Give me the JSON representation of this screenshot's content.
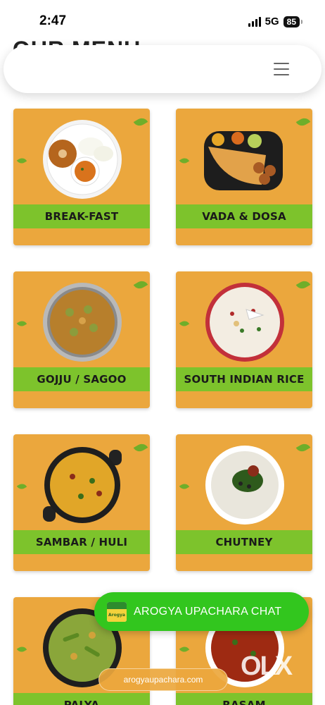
{
  "status": {
    "time": "2:47",
    "network": "5G",
    "battery": "85"
  },
  "header": {
    "title": "OUR MENU",
    "menu_icon": "hamburger-icon"
  },
  "categories": [
    {
      "label": "BREAK-FAST"
    },
    {
      "label": "VADA & DOSA"
    },
    {
      "label": "GOJJU / SAGOO"
    },
    {
      "label": "SOUTH INDIAN RICE"
    },
    {
      "label": "SAMBAR / HULI"
    },
    {
      "label": "CHUTNEY"
    },
    {
      "label": "PALYA"
    },
    {
      "label": "RASAM"
    }
  ],
  "chat": {
    "label": "AROGYA UPACHARA CHAT",
    "logo_text": "Arogya"
  },
  "url": "arogyaupachara.com",
  "watermark": "OLX",
  "colors": {
    "card": "#eba73d",
    "band": "#7dc32c",
    "chat": "#32c61e"
  }
}
